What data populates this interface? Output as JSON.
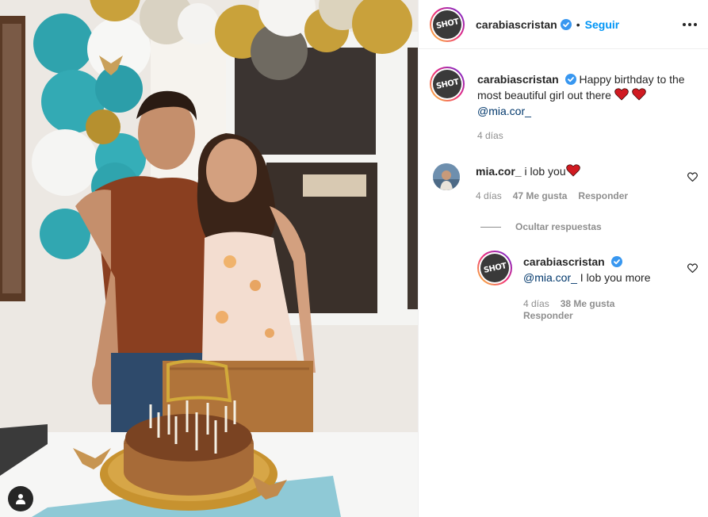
{
  "post": {
    "author": "carabiascristan",
    "follow_label": "Seguir",
    "dot": "•",
    "caption": {
      "username": "carabiascristan",
      "text": "Happy birthday to the most beautiful girl out there",
      "mention": "@mia.cor_",
      "time": "4 días"
    }
  },
  "comments": [
    {
      "username": "mia.cor_",
      "text": "i lob you",
      "time": "4 días",
      "likes": "47 Me gusta",
      "reply_label": "Responder"
    }
  ],
  "hide_replies_label": "Ocultar respuestas",
  "replies": [
    {
      "username": "carabiascristan",
      "mention": "@mia.cor_",
      "text": " I lob you more",
      "time": "4 días",
      "likes": "38 Me gusta",
      "reply_label": "Responder"
    }
  ],
  "avatar_label": "SHOT",
  "colors": {
    "accent": "#0095f6",
    "mention": "#00376b",
    "verified": "#3897f0",
    "heart": "#ed4956",
    "muted": "#8e8e8e"
  },
  "icons": [
    "verified-badge-icon",
    "more-options-icon",
    "heart-outline-icon",
    "red-heart-emoji",
    "user-tag-icon"
  ]
}
